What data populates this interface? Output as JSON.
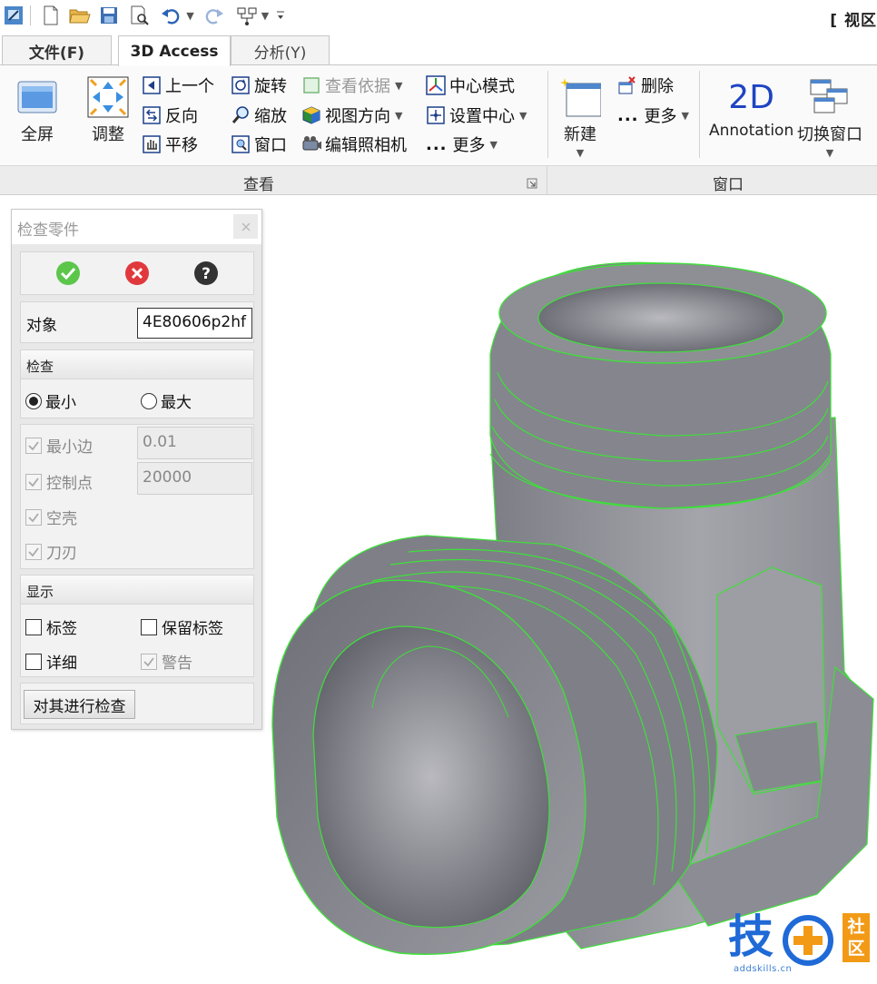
{
  "window": {
    "title_fragment": "[ 视区"
  },
  "tabs": [
    {
      "label": "文件(F)",
      "active": false
    },
    {
      "label": "3D Access",
      "active": true
    },
    {
      "label": "分析(Y)",
      "active": false
    }
  ],
  "ribbon": {
    "view_group": {
      "label": "查看",
      "fullscreen": "全屏",
      "adjust": "调整",
      "previous": "上一个",
      "reverse": "反向",
      "pan": "平移",
      "rotate": "旋转",
      "zoom": "缩放",
      "window": "窗口",
      "view_basis": "查看依据",
      "view_direction": "视图方向",
      "edit_camera": "编辑照相机",
      "center_mode": "中心模式",
      "set_center": "设置中心",
      "more": "更多"
    },
    "window_group": {
      "label": "窗口",
      "new": "新建",
      "delete": "删除",
      "more": "更多",
      "annotation_icon": "2D",
      "annotation": "Annotation",
      "switch_window": "切换窗口"
    }
  },
  "panel": {
    "title": "检查零件",
    "object_label": "对象",
    "object_value": "4E80606p2hf",
    "check_section": "检查",
    "radio_min": "最小",
    "radio_max": "最大",
    "radio_selected": "min",
    "min_edge_label": "最小边",
    "min_edge_value": "0.01",
    "control_points_label": "控制点",
    "control_points_value": "20000",
    "empty_shell_label": "空壳",
    "blade_label": "刀刃",
    "display_section": "显示",
    "label_cb": "标签",
    "keep_label_cb": "保留标签",
    "detail_cb": "详细",
    "warning_cb": "警告",
    "check_button": "对其进行检查"
  },
  "watermark": {
    "text": "技",
    "sub1": "社",
    "sub2": "区",
    "url": "addskills.cn"
  },
  "colors": {
    "accent_green": "#5cc64b",
    "cancel_red": "#e0383c",
    "edge_green": "#3ee03a",
    "model_gray": "#8f8f96"
  }
}
